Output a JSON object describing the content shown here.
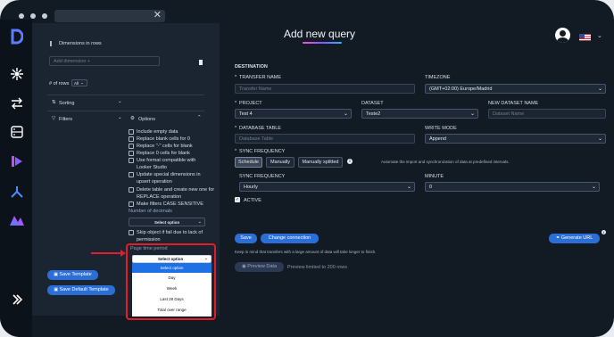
{
  "left_panel": {
    "dimensions_label": "Dimensions in rows",
    "add_dimension_placeholder": "Add dimension +",
    "rows_prefix": "# of rows",
    "rows_value": "All",
    "sorting_label": "Sorting",
    "filters_label": "Filters",
    "options_label": "Options",
    "options": [
      "Include empty data",
      "Replace blank cells for 0",
      "Replace \"-\" cells for blank",
      "Replace 0 cells for blank",
      "Use format compatible with Looker Studio",
      "Update special dimensions in upsert operation",
      "Delete table and create new one for REPLACE operation",
      "Make filters CASE SENSITIVE"
    ],
    "decimals_label": "Number of decimals",
    "decimals_value": "Select option",
    "skip_label": "Skip object if fail due to lack of permission",
    "time_period_label": "Page time period",
    "time_period_value": "Select option",
    "dropdown_options": [
      "Select option",
      "Day",
      "Week",
      "Last 28 Days",
      "Total over range"
    ],
    "save_template": "Save Template",
    "save_default_template": "Save Default Template"
  },
  "header": {
    "title": "Add new query",
    "accent": "#7b5cff"
  },
  "form": {
    "destination_label": "DESTINATION",
    "transfer_name_label": "TRANSFER NAME",
    "transfer_name_placeholder": "Transfer Name",
    "timezone_label": "TIMEZONE",
    "timezone_value": "(GMT+02:00) Europe/Madrid",
    "project_label": "PROJECT",
    "project_value": "Test 4",
    "dataset_label": "DATASET",
    "dataset_value": "Teste2",
    "new_dataset_label": "NEW DATASET NAME",
    "new_dataset_placeholder": "Dataset Name",
    "db_table_label": "DATABASE TABLE",
    "db_table_placeholder": "Database Table",
    "write_mode_label": "WRITE MODE",
    "write_mode_value": "Append",
    "sync_freq_label": "SYNC FREQUENCY",
    "sync_buttons": [
      "Schedule",
      "Manually",
      "Manually splitted"
    ],
    "sync_note": "Automate the import and synchronization of data at predefined intervals.",
    "sync_freq2_label": "SYNC FREQUENCY",
    "sync_freq2_value": "Hourly",
    "minute_label": "MINUTE",
    "minute_value": "0",
    "active_label": "ACTIVE",
    "save_label": "Save",
    "change_connection_label": "Change connection",
    "generate_url_label": "Generate URL",
    "transfer_note": "Keep in mind that transfers with a large amount of data will take longer to finish.",
    "preview_label": "Preview Data",
    "preview_note": "Preview limited to 200 rows"
  }
}
